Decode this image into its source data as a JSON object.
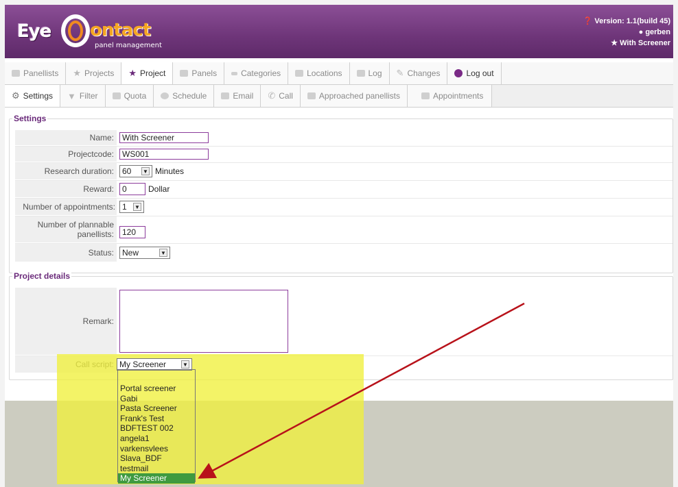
{
  "header": {
    "logo_text": "panel management",
    "version": "Version: 1.1(build 45)",
    "user": "gerben",
    "project": "With Screener"
  },
  "nav_main": [
    {
      "label": "Panellists",
      "icon": "users-icon"
    },
    {
      "label": "Projects",
      "icon": "star-icon"
    },
    {
      "label": "Project",
      "icon": "star-icon",
      "active": true
    },
    {
      "label": "Panels",
      "icon": "panels-icon"
    },
    {
      "label": "Categories",
      "icon": "tag-icon"
    },
    {
      "label": "Locations",
      "icon": "house-icon"
    },
    {
      "label": "Log",
      "icon": "log-icon"
    },
    {
      "label": "Changes",
      "icon": "pencil-icon"
    },
    {
      "label": "Log out",
      "icon": "power-icon"
    }
  ],
  "nav_sub": [
    {
      "label": "Settings",
      "icon": "gear-icon",
      "active": true
    },
    {
      "label": "Filter",
      "icon": "filter-icon"
    },
    {
      "label": "Quota",
      "icon": "quota-icon"
    },
    {
      "label": "Schedule",
      "icon": "clock-icon"
    },
    {
      "label": "Email",
      "icon": "mail-icon"
    },
    {
      "label": "Call",
      "icon": "phone-icon"
    },
    {
      "label": "Approached panellists",
      "icon": "users-icon"
    },
    {
      "label": "Appointments",
      "icon": "calendar-icon"
    }
  ],
  "settings": {
    "legend": "Settings",
    "name_label": "Name:",
    "name_value": "With Screener",
    "projectcode_label": "Projectcode:",
    "projectcode_value": "WS001",
    "duration_label": "Research duration:",
    "duration_value": "60",
    "duration_unit": "Minutes",
    "reward_label": "Reward:",
    "reward_value": "0",
    "reward_unit": "Dollar",
    "appointments_label": "Number of appointments:",
    "appointments_value": "1",
    "plannable_label_1": "Number of plannable",
    "plannable_label_2": "panellists:",
    "plannable_value": "120",
    "status_label": "Status:",
    "status_value": "New"
  },
  "details": {
    "legend": "Project details",
    "remark_label": "Remark:",
    "callscript_label": "Call script:",
    "callscript_value": "My Screener",
    "callscript_options": [
      "Portal screener",
      "Gabi",
      "Pasta Screener",
      "Frank's Test",
      "BDFTEST 002",
      "angela1",
      "varkensvlees",
      "Slava_BDF",
      "testmail",
      "My Screener"
    ]
  }
}
